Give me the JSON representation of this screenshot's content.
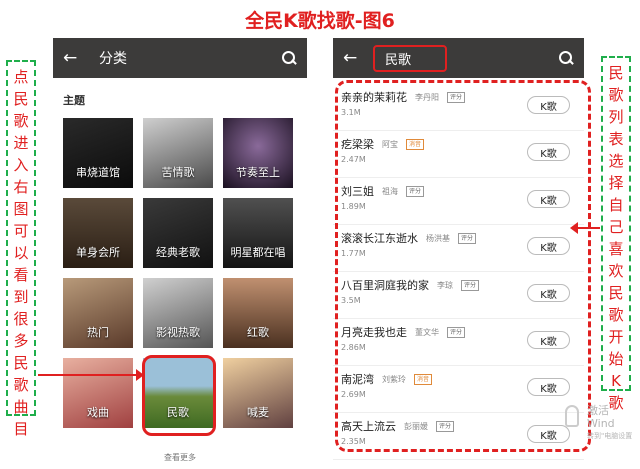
{
  "page_title": "全民K歌找歌-图6",
  "left_note": {
    "part1": [
      "点",
      "民",
      "歌",
      "进",
      "入",
      "右",
      "图"
    ],
    "part2": [
      "可",
      "以",
      "看",
      "到",
      "很",
      "多",
      "民",
      "歌",
      "曲",
      "目"
    ]
  },
  "right_note": {
    "part1": [
      "民",
      "歌",
      "列",
      "表"
    ],
    "part2": [
      "选",
      "择",
      "自",
      "己",
      "喜",
      "欢",
      "民",
      "歌",
      "开",
      "始",
      "K",
      "歌"
    ]
  },
  "left_screen": {
    "back_icon": "←",
    "title": "分类",
    "section": "主题",
    "tiles": [
      {
        "label": "串烧道馆",
        "bg": "linear-gradient(160deg,#2a2a2a,#0b0b0b)"
      },
      {
        "label": "苦情歌",
        "bg": "linear-gradient(160deg,#cfcfcf,#4a4a4a)"
      },
      {
        "label": "节奏至上",
        "bg": "radial-gradient(circle at 50% 40%,#8a6a9a,#1a1020)"
      },
      {
        "label": "单身会所",
        "bg": "linear-gradient(180deg,#5a4a3a,#2a1e14)"
      },
      {
        "label": "经典老歌",
        "bg": "linear-gradient(160deg,#3a3a3a,#111)"
      },
      {
        "label": "明星都在唱",
        "bg": "linear-gradient(180deg,#505050,#141414)"
      },
      {
        "label": "热门",
        "bg": "linear-gradient(160deg,#b89a7a,#5a3a2a)"
      },
      {
        "label": "影视热歌",
        "bg": "linear-gradient(160deg,#d0d0d0,#555)"
      },
      {
        "label": "红歌",
        "bg": "linear-gradient(180deg,#c09070,#4a3020)"
      },
      {
        "label": "戏曲",
        "bg": "linear-gradient(160deg,#e8b0a0,#a04040)"
      },
      {
        "label": "民歌",
        "bg": "linear-gradient(180deg,#9bc0d8 0%,#9bc0d8 40%,#6a8a3a 55%,#3f6a22 100%)"
      },
      {
        "label": "喊麦",
        "bg": "linear-gradient(160deg,#f0d0a0,#604040)"
      }
    ],
    "more": "查看更多"
  },
  "right_screen": {
    "back_icon": "←",
    "search_value": "民歌",
    "songs": [
      {
        "title": "亲亲的茉莉花",
        "artist": "李丹阳",
        "tag": "评分",
        "hq": false,
        "count": "3.1M",
        "button": "K歌"
      },
      {
        "title": "疙梁梁",
        "artist": "阿宝",
        "tag": "消音",
        "hq": true,
        "count": "2.47M",
        "button": "K歌"
      },
      {
        "title": "刘三姐",
        "artist": "祖海",
        "tag": "评分",
        "hq": false,
        "count": "1.89M",
        "button": "K歌"
      },
      {
        "title": "滚滚长江东逝水",
        "artist": "杨洪基",
        "tag": "评分",
        "hq": false,
        "count": "1.77M",
        "button": "K歌"
      },
      {
        "title": "八百里洞庭我的家",
        "artist": "李琼",
        "tag": "评分",
        "hq": false,
        "count": "3.5M",
        "button": "K歌"
      },
      {
        "title": "月亮走我也走",
        "artist": "董文华",
        "tag": "评分",
        "hq": false,
        "count": "2.86M",
        "button": "K歌"
      },
      {
        "title": "南泥湾",
        "artist": "刘紫玲",
        "tag": "消音",
        "hq": true,
        "count": "2.69M",
        "button": "K歌"
      },
      {
        "title": "高天上流云",
        "artist": "彭丽媛",
        "tag": "评分",
        "hq": false,
        "count": "2.35M",
        "button": "K歌"
      }
    ]
  },
  "watermark": {
    "line1": "激活 Wind",
    "line2": "转到\"电脑设置"
  }
}
